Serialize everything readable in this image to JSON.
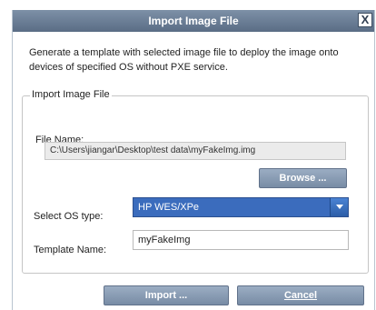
{
  "window": {
    "title": "Import Image File",
    "close_glyph": "X"
  },
  "description": "Generate a template with selected image file to deploy the image onto devices of specified OS without PXE service.",
  "group": {
    "legend": "Import Image File"
  },
  "file": {
    "label": "File Name:",
    "value": "C:\\Users\\jiangar\\Desktop\\test data\\myFakeImg.img",
    "browse_label": "Browse ..."
  },
  "os_type": {
    "label": "Select OS type:",
    "selected": "HP WES/XPe"
  },
  "template": {
    "label": "Template Name:",
    "value": "myFakeImg"
  },
  "buttons": {
    "import_label": "Import ...",
    "cancel_label": "Cancel"
  },
  "colors": {
    "titlebar": "#5a6d85",
    "button": "#788ca5",
    "select_highlight": "#3b6cbd"
  },
  "icons": [
    "close-icon",
    "chevron-down-icon"
  ]
}
